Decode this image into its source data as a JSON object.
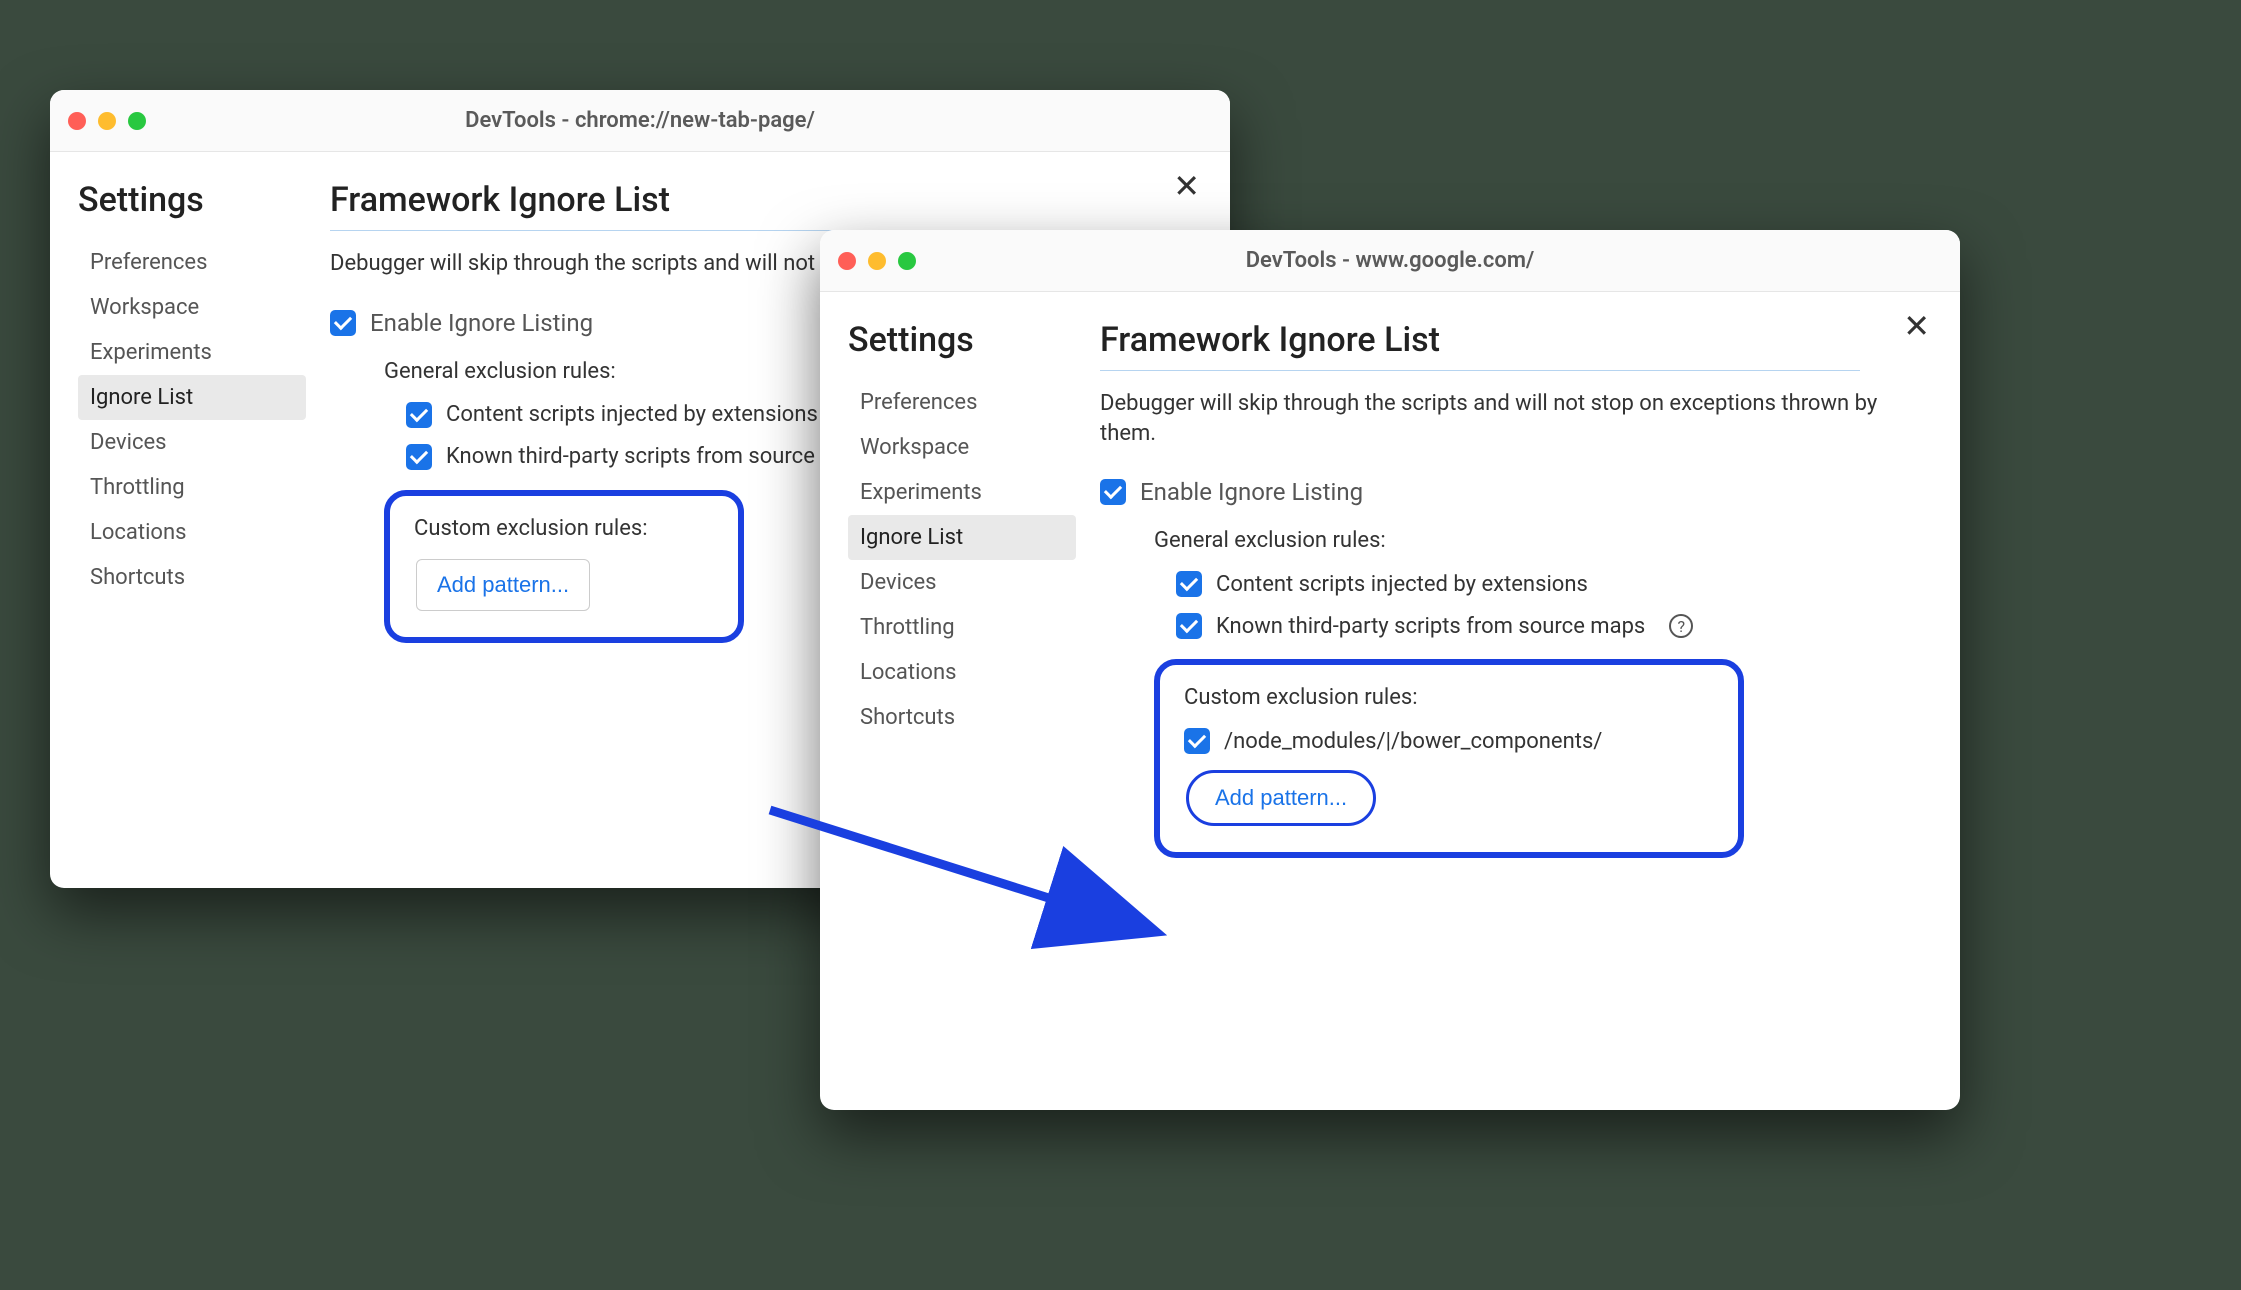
{
  "windows": {
    "left": {
      "title": "DevTools - chrome://new-tab-page/",
      "settings_title": "Settings",
      "nav": [
        "Preferences",
        "Workspace",
        "Experiments",
        "Ignore List",
        "Devices",
        "Throttling",
        "Locations",
        "Shortcuts"
      ],
      "active_nav": "Ignore List",
      "heading": "Framework Ignore List",
      "description": "Debugger will skip through the scripts and will not stop on exceptions thrown by them.",
      "enable_label": "Enable Ignore Listing",
      "general_title": "General exclusion rules:",
      "rule1": "Content scripts injected by extensions",
      "rule2": "Known third-party scripts from source maps",
      "custom_title": "Custom exclusion rules:",
      "add_label": "Add pattern..."
    },
    "right": {
      "title": "DevTools - www.google.com/",
      "settings_title": "Settings",
      "nav": [
        "Preferences",
        "Workspace",
        "Experiments",
        "Ignore List",
        "Devices",
        "Throttling",
        "Locations",
        "Shortcuts"
      ],
      "active_nav": "Ignore List",
      "heading": "Framework Ignore List",
      "description": "Debugger will skip through the scripts and will not stop on exceptions thrown by them.",
      "enable_label": "Enable Ignore Listing",
      "general_title": "General exclusion rules:",
      "rule1": "Content scripts injected by extensions",
      "rule2": "Known third-party scripts from source maps",
      "custom_title": "Custom exclusion rules:",
      "existing_pattern": "/node_modules/|/bower_components/",
      "add_label": "Add pattern..."
    }
  },
  "colors": {
    "accent": "#1a73e8",
    "callout_border": "#1a3fe0"
  }
}
